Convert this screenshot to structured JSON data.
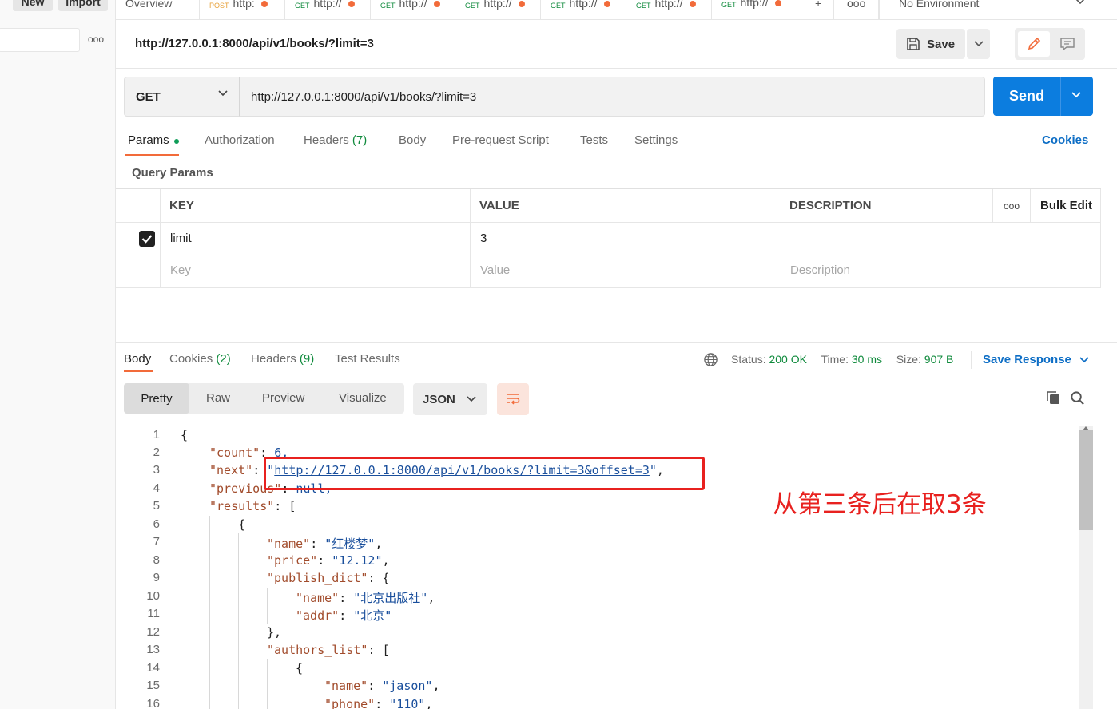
{
  "sidebar": {
    "new_label": "New",
    "import_label": "Import",
    "more_label": "ooo"
  },
  "tabs": [
    {
      "label": "Overview",
      "method": ""
    },
    {
      "label": "http:",
      "method": "POST"
    },
    {
      "label": "http://",
      "method": "GET"
    },
    {
      "label": "http://",
      "method": "GET"
    },
    {
      "label": "http://",
      "method": "GET"
    },
    {
      "label": "http://",
      "method": "GET"
    },
    {
      "label": "http://",
      "method": "GET"
    },
    {
      "label": "http://",
      "method": "GET"
    }
  ],
  "tabstrip_more": "ooo",
  "environment": "No Environment",
  "request": {
    "title": "http://127.0.0.1:8000/api/v1/books/?limit=3",
    "save_label": "Save",
    "method": "GET",
    "url": "http://127.0.0.1:8000/api/v1/books/?limit=3",
    "send_label": "Send"
  },
  "request_tabs": {
    "params": "Params",
    "authorization": "Authorization",
    "headers": "Headers",
    "headers_count": "(7)",
    "body": "Body",
    "prerequest": "Pre-request Script",
    "tests": "Tests",
    "settings": "Settings",
    "cookies": "Cookies"
  },
  "query_params": {
    "label": "Query Params",
    "headers": {
      "key": "KEY",
      "value": "VALUE",
      "description": "DESCRIPTION",
      "more": "ooo",
      "bulk_edit": "Bulk Edit"
    },
    "rows": [
      {
        "key": "limit",
        "value": "3",
        "description": "",
        "checked": true
      }
    ],
    "placeholders": {
      "key": "Key",
      "value": "Value",
      "description": "Description"
    }
  },
  "response": {
    "tabs": {
      "body": "Body",
      "cookies": "Cookies",
      "cookies_count": "(2)",
      "headers": "Headers",
      "headers_count": "(9)",
      "test_results": "Test Results"
    },
    "status_label": "Status:",
    "status_value": "200 OK",
    "time_label": "Time:",
    "time_value": "30 ms",
    "size_label": "Size:",
    "size_value": "907 B",
    "save_response": "Save Response",
    "views": {
      "pretty": "Pretty",
      "raw": "Raw",
      "preview": "Preview",
      "visualize": "Visualize"
    },
    "format": "JSON",
    "line_numbers": [
      "1",
      "2",
      "3",
      "4",
      "5",
      "6",
      "7",
      "8",
      "9",
      "10",
      "11",
      "12",
      "13",
      "14",
      "15",
      "16"
    ],
    "code": {
      "l1": "{",
      "count_key": "\"count\"",
      "count_val": "6,",
      "next_key": "\"next\"",
      "next_val": "http://127.0.0.1:8000/api/v1/books/?limit=3&offset=3",
      "previous_key": "\"previous\"",
      "previous_val": "null,",
      "results_key": "\"results\"",
      "l6": "{",
      "name_key": "\"name\"",
      "name_val": "\"红楼梦\"",
      "price_key": "\"price\"",
      "price_val": "\"12.12\"",
      "publish_key": "\"publish_dict\"",
      "pub_name_key": "\"name\"",
      "pub_name_val": "\"北京出版社\"",
      "pub_addr_key": "\"addr\"",
      "pub_addr_val": "\"北京\"",
      "l12": "},",
      "authors_key": "\"authors_list\"",
      "l14": "{",
      "author_name_key": "\"name\"",
      "author_name_val": "\"jason\"",
      "author_phone_key": "\"phone\"",
      "author_phone_val": "\"110\""
    }
  },
  "annotation": {
    "text": "从第三条后在取3条",
    "color": "#e8211f"
  },
  "colors": {
    "accent": "#f26b3a",
    "send": "#0c7ddf",
    "link": "#0c6dc5",
    "success": "#0f8a3c"
  }
}
